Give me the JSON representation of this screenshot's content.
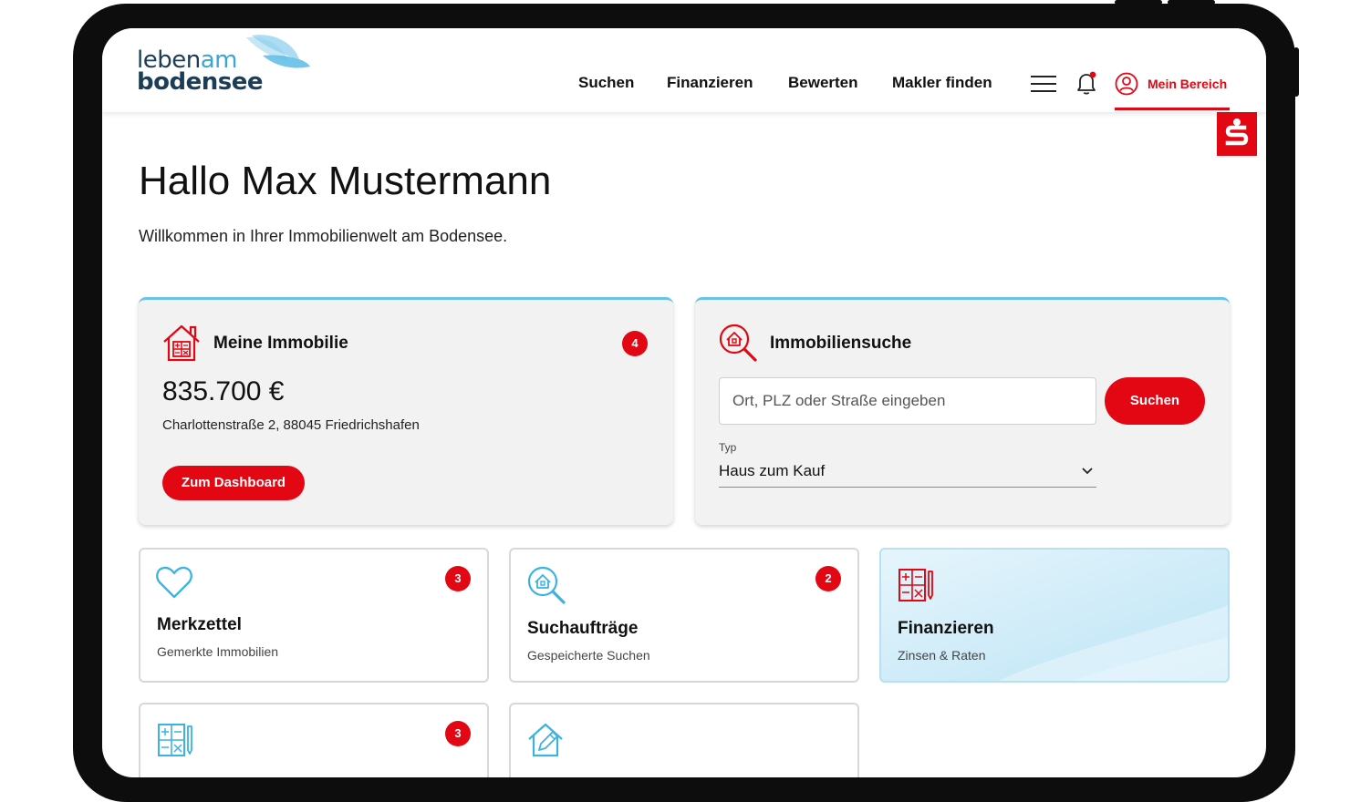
{
  "brand": {
    "logo_line1_a": "leben",
    "logo_line1_b": "am",
    "logo_line2": "bodensee",
    "accent_color": "#e30613",
    "secondary_color": "#3aa6d6"
  },
  "nav": {
    "items": [
      "Suchen",
      "Finanzieren",
      "Bewerten",
      "Makler finden"
    ],
    "menu_icon": "hamburger-icon",
    "notification_icon": "bell-icon",
    "account_label": "Mein Bereich",
    "account_icon": "user-circle-icon",
    "bank_icon": "sparkasse-s-icon"
  },
  "greeting": {
    "title": "Hallo Max Mustermann",
    "subtitle": "Willkommen in Ihrer Immobilienwelt am Bodensee."
  },
  "my_property": {
    "title": "Meine Immobilie",
    "badge": "4",
    "price": "835.700 €",
    "address": "Charlottenstraße 2, 88045 Friedrichshafen",
    "button": "Zum Dashboard",
    "icon": "house-calculator-icon"
  },
  "property_search": {
    "title": "Immobiliensuche",
    "placeholder": "Ort, PLZ oder Straße eingeben",
    "button": "Suchen",
    "type_label": "Typ",
    "type_value": "Haus zum Kauf",
    "icon": "house-search-icon"
  },
  "tiles": [
    {
      "title": "Merkzettel",
      "subtitle": "Gemerkte Immobilien",
      "badge": "3",
      "icon": "heart-icon"
    },
    {
      "title": "Suchaufträge",
      "subtitle": "Gespeicherte Suchen",
      "badge": "2",
      "icon": "house-search-icon"
    },
    {
      "title": "Finanzieren",
      "subtitle": "Zinsen & Raten",
      "badge": "",
      "icon": "calculator-icon"
    },
    {
      "title": "",
      "subtitle": "",
      "badge": "3",
      "icon": "calculator-icon"
    },
    {
      "title": "",
      "subtitle": "",
      "badge": "",
      "icon": "house-edit-icon"
    }
  ]
}
